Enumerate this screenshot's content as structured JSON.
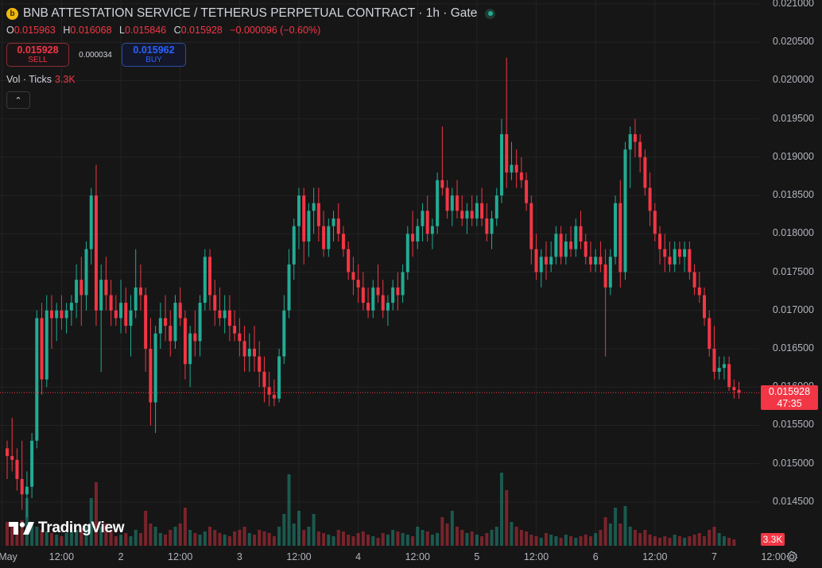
{
  "header": {
    "title": "BNB ATTESTATION SERVICE / TETHERUS PERPETUAL CONTRACT · 1h · Gate",
    "coin_icon_glyph": "b",
    "status": "market-open"
  },
  "ohlc": {
    "o_key": "O",
    "o_value": "0.015963",
    "h_key": "H",
    "h_value": "0.016068",
    "l_key": "L",
    "l_value": "0.015846",
    "c_key": "C",
    "c_value": "0.015928",
    "change": "−0.000096 (−0.60%)"
  },
  "trade": {
    "sell_price": "0.015928",
    "sell_label": "SELL",
    "spread": "0.000034",
    "buy_price": "0.015962",
    "buy_label": "BUY"
  },
  "volume_legend": {
    "label": "Vol · Ticks",
    "value": "3.3K"
  },
  "collapse_glyph": "⌃",
  "last_price": {
    "price": "0.015928",
    "countdown": "47:35"
  },
  "volume_tag": "3.3K",
  "logo_text": "TradingView",
  "colors": {
    "up": "#22ab94",
    "down": "#f23645",
    "background": "#161616",
    "grid": "#232323",
    "text": "#b2b5be"
  },
  "chart_data": {
    "type": "candlestick",
    "timeframe": "1h",
    "y_ticks": [
      "0.021000",
      "0.020500",
      "0.020000",
      "0.019500",
      "0.019000",
      "0.018500",
      "0.018000",
      "0.017500",
      "0.017000",
      "0.016500",
      "0.016000",
      "0.015500",
      "0.015000",
      "0.014500"
    ],
    "x_ticks": [
      "May",
      "12:00",
      "2",
      "12:00",
      "3",
      "12:00",
      "4",
      "12:00",
      "5",
      "12:00",
      "6",
      "12:00",
      "7",
      "12:00"
    ],
    "ylim": [
      0.01395,
      0.02102
    ],
    "grid": true,
    "candles": [
      [
        0.0152,
        0.0153,
        0.0148,
        0.0151
      ],
      [
        0.0151,
        0.0156,
        0.0149,
        0.01505
      ],
      [
        0.01505,
        0.0152,
        0.01465,
        0.0148
      ],
      [
        0.0148,
        0.0153,
        0.0144,
        0.0146
      ],
      [
        0.0146,
        0.0149,
        0.0143,
        0.0147
      ],
      [
        0.0147,
        0.0154,
        0.01455,
        0.0153
      ],
      [
        0.0153,
        0.017,
        0.0152,
        0.0169
      ],
      [
        0.0169,
        0.0171,
        0.0159,
        0.0161
      ],
      [
        0.0161,
        0.0172,
        0.016,
        0.017
      ],
      [
        0.017,
        0.0172,
        0.0165,
        0.0169
      ],
      [
        0.0169,
        0.0171,
        0.0166,
        0.017
      ],
      [
        0.017,
        0.0172,
        0.01675,
        0.0169
      ],
      [
        0.0169,
        0.0171,
        0.0167,
        0.017
      ],
      [
        0.017,
        0.0172,
        0.0168,
        0.0171
      ],
      [
        0.0171,
        0.0176,
        0.0169,
        0.0174
      ],
      [
        0.0174,
        0.0177,
        0.0168,
        0.0172
      ],
      [
        0.0172,
        0.0179,
        0.017,
        0.0178
      ],
      [
        0.0178,
        0.0186,
        0.0176,
        0.0185
      ],
      [
        0.0185,
        0.0189,
        0.0168,
        0.017
      ],
      [
        0.017,
        0.0176,
        0.0162,
        0.0174
      ],
      [
        0.0174,
        0.0177,
        0.017,
        0.0172
      ],
      [
        0.0172,
        0.0174,
        0.0168,
        0.017
      ],
      [
        0.017,
        0.0172,
        0.0168,
        0.0169
      ],
      [
        0.0169,
        0.0174,
        0.0167,
        0.0171
      ],
      [
        0.0171,
        0.0173,
        0.0167,
        0.0168
      ],
      [
        0.0168,
        0.0172,
        0.0164,
        0.017
      ],
      [
        0.017,
        0.0178,
        0.0169,
        0.0173
      ],
      [
        0.0173,
        0.0176,
        0.017,
        0.0172
      ],
      [
        0.0172,
        0.0173,
        0.0162,
        0.0165
      ],
      [
        0.0165,
        0.0169,
        0.0155,
        0.0158
      ],
      [
        0.0158,
        0.0168,
        0.0154,
        0.0167
      ],
      [
        0.0167,
        0.0171,
        0.0165,
        0.0169
      ],
      [
        0.0169,
        0.0172,
        0.0166,
        0.0168
      ],
      [
        0.0168,
        0.017,
        0.0164,
        0.0166
      ],
      [
        0.0166,
        0.0172,
        0.0165,
        0.0171
      ],
      [
        0.0171,
        0.0173,
        0.0168,
        0.0169
      ],
      [
        0.0169,
        0.017,
        0.0161,
        0.0163
      ],
      [
        0.0163,
        0.0168,
        0.016,
        0.0167
      ],
      [
        0.0167,
        0.017,
        0.0164,
        0.0166
      ],
      [
        0.0166,
        0.0172,
        0.0164,
        0.0171
      ],
      [
        0.0171,
        0.0178,
        0.017,
        0.0177
      ],
      [
        0.0177,
        0.0178,
        0.017,
        0.0172
      ],
      [
        0.0172,
        0.0174,
        0.0168,
        0.017
      ],
      [
        0.017,
        0.0173,
        0.0168,
        0.0169
      ],
      [
        0.0169,
        0.0172,
        0.0167,
        0.017
      ],
      [
        0.017,
        0.0172,
        0.0166,
        0.0168
      ],
      [
        0.0168,
        0.017,
        0.0166,
        0.0167
      ],
      [
        0.0167,
        0.0169,
        0.0164,
        0.0166
      ],
      [
        0.0166,
        0.0168,
        0.0162,
        0.0164
      ],
      [
        0.0164,
        0.0167,
        0.0162,
        0.0165
      ],
      [
        0.0165,
        0.0168,
        0.0162,
        0.0164
      ],
      [
        0.0164,
        0.0166,
        0.016,
        0.0162
      ],
      [
        0.0162,
        0.0164,
        0.0158,
        0.016
      ],
      [
        0.016,
        0.0162,
        0.01575,
        0.0159
      ],
      [
        0.0159,
        0.0161,
        0.01575,
        0.01585
      ],
      [
        0.01585,
        0.0165,
        0.0158,
        0.0164
      ],
      [
        0.0164,
        0.0172,
        0.0163,
        0.017
      ],
      [
        0.017,
        0.0178,
        0.0169,
        0.0176
      ],
      [
        0.0176,
        0.0182,
        0.0174,
        0.0181
      ],
      [
        0.0181,
        0.0186,
        0.0178,
        0.0185
      ],
      [
        0.0185,
        0.0186,
        0.0176,
        0.0179
      ],
      [
        0.0179,
        0.0184,
        0.0177,
        0.0183
      ],
      [
        0.0183,
        0.0186,
        0.018,
        0.0184
      ],
      [
        0.0184,
        0.0186,
        0.0179,
        0.0181
      ],
      [
        0.0181,
        0.0183,
        0.0177,
        0.0178
      ],
      [
        0.0178,
        0.0182,
        0.0177,
        0.0181
      ],
      [
        0.0181,
        0.0183,
        0.0179,
        0.0182
      ],
      [
        0.0182,
        0.0184,
        0.0179,
        0.018
      ],
      [
        0.018,
        0.0181,
        0.0177,
        0.0178
      ],
      [
        0.0178,
        0.0179,
        0.0174,
        0.0175
      ],
      [
        0.0175,
        0.0177,
        0.0172,
        0.0174
      ],
      [
        0.0174,
        0.0176,
        0.0171,
        0.0173
      ],
      [
        0.0173,
        0.0175,
        0.017,
        0.0171
      ],
      [
        0.0171,
        0.0173,
        0.0169,
        0.017
      ],
      [
        0.017,
        0.0174,
        0.0169,
        0.0173
      ],
      [
        0.0173,
        0.0176,
        0.0171,
        0.0172
      ],
      [
        0.0172,
        0.0174,
        0.0169,
        0.017
      ],
      [
        0.017,
        0.0172,
        0.0168,
        0.0171
      ],
      [
        0.0171,
        0.0174,
        0.017,
        0.0173
      ],
      [
        0.0173,
        0.0175,
        0.017,
        0.0172
      ],
      [
        0.0172,
        0.0176,
        0.0171,
        0.0175
      ],
      [
        0.0175,
        0.0181,
        0.0174,
        0.018
      ],
      [
        0.018,
        0.0183,
        0.0177,
        0.0179
      ],
      [
        0.0179,
        0.0182,
        0.0178,
        0.0181
      ],
      [
        0.0181,
        0.0184,
        0.0179,
        0.0183
      ],
      [
        0.0183,
        0.0185,
        0.0179,
        0.018
      ],
      [
        0.018,
        0.0182,
        0.0178,
        0.0181
      ],
      [
        0.0181,
        0.0188,
        0.018,
        0.0187
      ],
      [
        0.0187,
        0.0194,
        0.0185,
        0.0186
      ],
      [
        0.0186,
        0.0187,
        0.0182,
        0.0183
      ],
      [
        0.0183,
        0.0186,
        0.0181,
        0.0185
      ],
      [
        0.0185,
        0.0187,
        0.0182,
        0.0183
      ],
      [
        0.0183,
        0.0185,
        0.0181,
        0.0182
      ],
      [
        0.0182,
        0.0184,
        0.018,
        0.0183
      ],
      [
        0.0183,
        0.0185,
        0.0181,
        0.0182
      ],
      [
        0.0182,
        0.0185,
        0.0181,
        0.0184
      ],
      [
        0.0184,
        0.0186,
        0.0181,
        0.0182
      ],
      [
        0.0182,
        0.0184,
        0.0179,
        0.018
      ],
      [
        0.018,
        0.0183,
        0.0178,
        0.0182
      ],
      [
        0.0182,
        0.0186,
        0.0181,
        0.0185
      ],
      [
        0.0185,
        0.0195,
        0.0184,
        0.0193
      ],
      [
        0.0193,
        0.0203,
        0.0186,
        0.0188
      ],
      [
        0.0188,
        0.0192,
        0.0187,
        0.0189
      ],
      [
        0.0189,
        0.0191,
        0.0186,
        0.0188
      ],
      [
        0.0188,
        0.019,
        0.0186,
        0.0187
      ],
      [
        0.0187,
        0.0188,
        0.0183,
        0.0184
      ],
      [
        0.0184,
        0.0185,
        0.0176,
        0.0178
      ],
      [
        0.0178,
        0.018,
        0.0174,
        0.0175
      ],
      [
        0.0175,
        0.0178,
        0.0173,
        0.0177
      ],
      [
        0.0177,
        0.0179,
        0.0174,
        0.0176
      ],
      [
        0.0176,
        0.0179,
        0.0175,
        0.0177
      ],
      [
        0.0177,
        0.0181,
        0.0176,
        0.018
      ],
      [
        0.018,
        0.0181,
        0.0176,
        0.0177
      ],
      [
        0.0177,
        0.018,
        0.0176,
        0.0179
      ],
      [
        0.0179,
        0.0181,
        0.0177,
        0.0178
      ],
      [
        0.0178,
        0.0182,
        0.0177,
        0.0181
      ],
      [
        0.0181,
        0.0183,
        0.0178,
        0.0179
      ],
      [
        0.0179,
        0.018,
        0.0176,
        0.0177
      ],
      [
        0.0177,
        0.0179,
        0.0175,
        0.0176
      ],
      [
        0.0176,
        0.0178,
        0.0175,
        0.0177
      ],
      [
        0.0177,
        0.0179,
        0.0175,
        0.0176
      ],
      [
        0.0176,
        0.0178,
        0.0164,
        0.0173
      ],
      [
        0.0173,
        0.0178,
        0.0172,
        0.0177
      ],
      [
        0.0177,
        0.0185,
        0.0176,
        0.0184
      ],
      [
        0.0184,
        0.0187,
        0.0173,
        0.0175
      ],
      [
        0.0175,
        0.0192,
        0.0174,
        0.0191
      ],
      [
        0.0191,
        0.0194,
        0.0186,
        0.0193
      ],
      [
        0.0193,
        0.0195,
        0.019,
        0.0192
      ],
      [
        0.0192,
        0.0193,
        0.0188,
        0.019
      ],
      [
        0.019,
        0.0191,
        0.0185,
        0.0186
      ],
      [
        0.0186,
        0.0188,
        0.0181,
        0.0183
      ],
      [
        0.0183,
        0.0184,
        0.0179,
        0.018
      ],
      [
        0.018,
        0.0181,
        0.0176,
        0.0178
      ],
      [
        0.0178,
        0.018,
        0.0175,
        0.0177
      ],
      [
        0.0177,
        0.0179,
        0.0175,
        0.0176
      ],
      [
        0.0176,
        0.0179,
        0.0175,
        0.0178
      ],
      [
        0.0178,
        0.0179,
        0.0176,
        0.0177
      ],
      [
        0.0177,
        0.0179,
        0.0175,
        0.0178
      ],
      [
        0.0178,
        0.0179,
        0.0174,
        0.0175
      ],
      [
        0.0175,
        0.0176,
        0.0172,
        0.0173
      ],
      [
        0.0173,
        0.0175,
        0.0171,
        0.0172
      ],
      [
        0.0172,
        0.0173,
        0.0168,
        0.0169
      ],
      [
        0.0169,
        0.017,
        0.0164,
        0.0165
      ],
      [
        0.0165,
        0.0168,
        0.0161,
        0.0162
      ],
      [
        0.0162,
        0.0164,
        0.0161,
        0.01625
      ],
      [
        0.01625,
        0.0164,
        0.0161,
        0.0163
      ],
      [
        0.0163,
        0.0164,
        0.01595,
        0.016
      ],
      [
        0.016,
        0.0161,
        0.01585,
        0.01596
      ],
      [
        0.015963,
        0.016068,
        0.015846,
        0.015928
      ]
    ],
    "volumes": [
      0.15,
      0.12,
      0.1,
      0.16,
      0.3,
      0.14,
      0.12,
      0.1,
      0.09,
      0.08,
      0.07,
      0.06,
      0.08,
      0.09,
      0.1,
      0.11,
      0.12,
      0.3,
      0.4,
      0.12,
      0.14,
      0.1,
      0.06,
      0.07,
      0.08,
      0.06,
      0.1,
      0.08,
      0.22,
      0.14,
      0.12,
      0.08,
      0.07,
      0.1,
      0.12,
      0.14,
      0.24,
      0.1,
      0.08,
      0.07,
      0.09,
      0.12,
      0.1,
      0.08,
      0.07,
      0.06,
      0.09,
      0.1,
      0.12,
      0.08,
      0.07,
      0.1,
      0.09,
      0.08,
      0.06,
      0.12,
      0.2,
      0.45,
      0.14,
      0.22,
      0.1,
      0.12,
      0.2,
      0.09,
      0.08,
      0.07,
      0.06,
      0.1,
      0.09,
      0.07,
      0.06,
      0.08,
      0.09,
      0.07,
      0.06,
      0.05,
      0.08,
      0.07,
      0.1,
      0.09,
      0.08,
      0.07,
      0.06,
      0.12,
      0.1,
      0.09,
      0.07,
      0.08,
      0.18,
      0.14,
      0.22,
      0.12,
      0.1,
      0.08,
      0.09,
      0.07,
      0.06,
      0.08,
      0.1,
      0.12,
      0.46,
      0.35,
      0.15,
      0.12,
      0.1,
      0.09,
      0.07,
      0.06,
      0.05,
      0.08,
      0.07,
      0.06,
      0.05,
      0.07,
      0.06,
      0.05,
      0.06,
      0.07,
      0.06,
      0.08,
      0.1,
      0.18,
      0.14,
      0.24,
      0.14,
      0.25,
      0.12,
      0.1,
      0.08,
      0.1,
      0.07,
      0.06,
      0.05,
      0.06,
      0.05,
      0.07,
      0.06,
      0.05,
      0.06,
      0.07,
      0.08,
      0.06,
      0.1,
      0.12,
      0.08,
      0.06,
      0.05,
      0.04
    ]
  }
}
